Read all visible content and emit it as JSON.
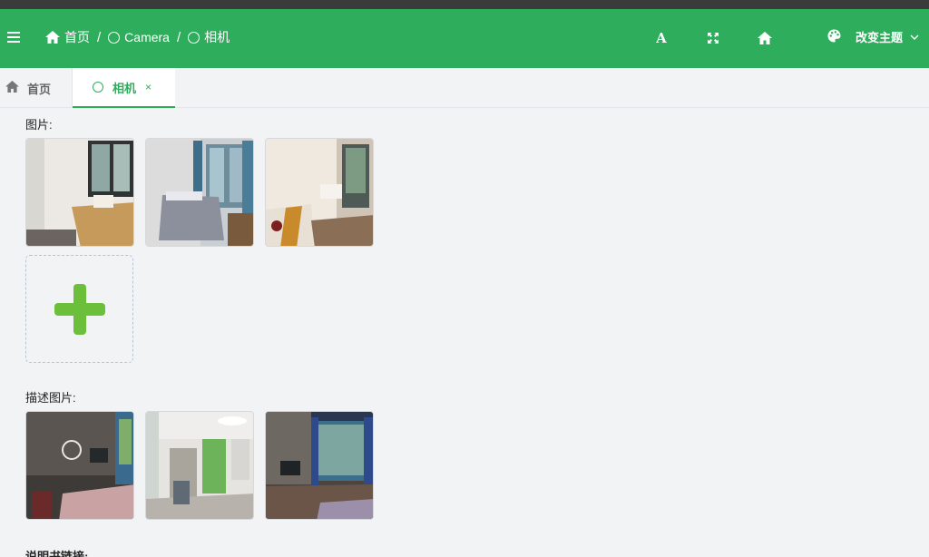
{
  "header": {
    "breadcrumbs": [
      "首页",
      "Camera",
      "相机"
    ],
    "separator": "/",
    "font_icon_glyph": "A",
    "theme_label": "改变主题",
    "accent_color": "#2eae5c"
  },
  "tabs": [
    {
      "label": "首页",
      "icon": "home-icon"
    },
    {
      "label": "相机",
      "icon": "circle-icon",
      "close": "×",
      "active": true
    }
  ],
  "sections": {
    "images_label": "图片:",
    "described_images_label": "描述图片:",
    "manual_link_label": "说明书链接:"
  },
  "upload": {
    "icon": "plus-icon",
    "color": "#6bbf3a"
  },
  "images": [
    {
      "name": "kitchen-corner-photo"
    },
    {
      "name": "bedroom-window-photo"
    },
    {
      "name": "room-dining-photo"
    }
  ],
  "described_images": [
    {
      "name": "dark-bedroom-photo"
    },
    {
      "name": "green-door-room-photo"
    },
    {
      "name": "window-desk-photo"
    }
  ]
}
